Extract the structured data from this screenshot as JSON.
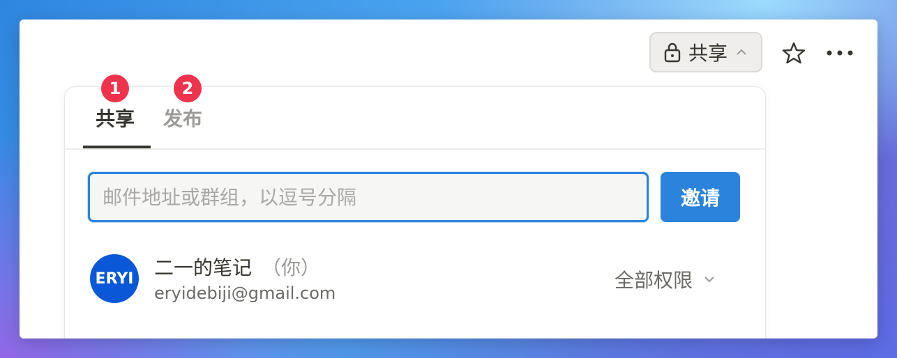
{
  "topbar": {
    "share_button_label": "共享",
    "share_button_icon": "lock-icon",
    "share_chevron_icon": "chevron-up-icon",
    "favorite_icon": "star-icon",
    "more_icon": "more-horizontal-icon"
  },
  "share_panel": {
    "tabs": [
      {
        "label": "共享",
        "badge": "1",
        "active": true
      },
      {
        "label": "发布",
        "badge": "2",
        "active": false
      }
    ],
    "invite": {
      "placeholder": "邮件地址或群组，以逗号分隔",
      "value": "",
      "button_label": "邀请"
    },
    "members": [
      {
        "avatar_text": "ERYI",
        "name": "二一的笔记",
        "you_label": "（你）",
        "email": "eryidebiji@gmail.com",
        "permission": "全部权限",
        "permission_icon": "chevron-down-icon"
      }
    ]
  },
  "colors": {
    "accent": "#2b83db",
    "badge": "#f0334c",
    "avatar": "#0a58d8",
    "text_primary": "#37352f",
    "text_secondary": "#9b9a97"
  }
}
